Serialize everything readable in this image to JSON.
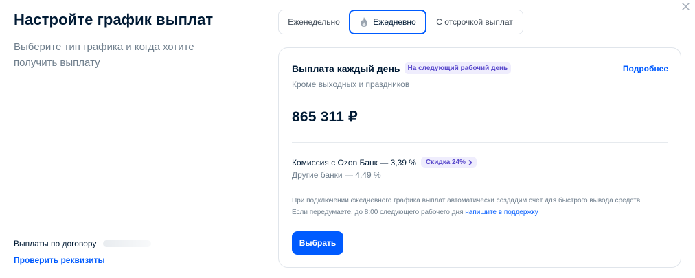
{
  "header": {
    "title": "Настройте график выплат",
    "subtitle": "Выберите тип графика и когда хотите получить выплату",
    "close_icon": "close-icon"
  },
  "footer": {
    "contract_label": "Выплаты по договору",
    "check_link": "Проверить реквизиты"
  },
  "tabs": [
    {
      "label": "Еженедельно",
      "active": false
    },
    {
      "label": "Ежедневно",
      "active": true,
      "icon": "fire-icon"
    },
    {
      "label": "С отсрочкой выплат",
      "active": false
    }
  ],
  "card": {
    "title": "Выплата каждый день",
    "badge": "На следующий рабочий день",
    "more_link": "Подробнее",
    "subtitle": "Кроме выходных и праздников",
    "amount": "865 311 ₽",
    "fee_text": "Комиссия с Ozon Банк — 3,39 %",
    "discount": "Скидка 24%",
    "other_banks": "Другие банки — 4,49 %",
    "notice_text": "При подключении ежедневного графика выплат автоматически создадим счёт для быстрого вывода средств. Если передумаете, до 8:00 следующего рабочего дня ",
    "notice_link": "напишите в поддержку",
    "select_button": "Выбрать"
  },
  "colors": {
    "accent": "#005bff",
    "badge_bg": "#efedfd",
    "badge_text": "#5b4bcc",
    "text_primary": "#001a34",
    "text_secondary": "#707f8d"
  }
}
